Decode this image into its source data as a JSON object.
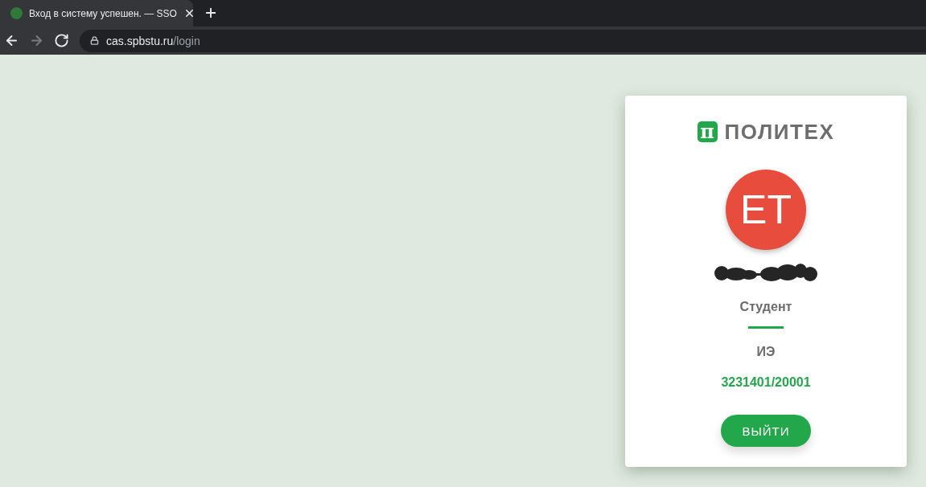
{
  "browser": {
    "tab": {
      "title": "Вход в систему успешен. — SSO",
      "selected": true
    },
    "navigation": [
      {
        "kind": "back",
        "disabled": false
      },
      {
        "kind": "forward",
        "disabled": true
      },
      {
        "kind": "reload",
        "disabled": false
      }
    ],
    "address_bar": {
      "host": "cas.spbstu.ru",
      "path": "/login"
    }
  },
  "card": {
    "logo": {
      "mark": "π",
      "text": "ПОЛИТЕХ"
    },
    "avatar": {
      "initials": "ET"
    },
    "name_redacted": true,
    "role": "Студент",
    "department": "ИЭ",
    "group": "3231401/20001",
    "logout_button": "ВЫЙТИ"
  }
}
